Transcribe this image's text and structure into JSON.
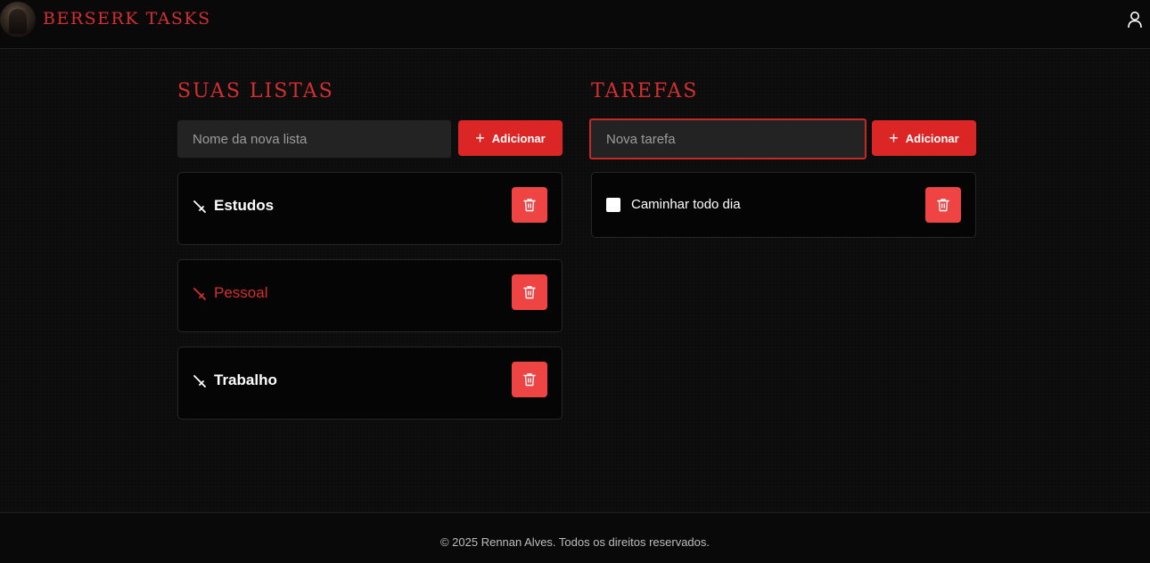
{
  "header": {
    "brand": "BERSERK TASKS",
    "user_icon": "user-icon"
  },
  "lists": {
    "title": "SUAS LISTAS",
    "input_placeholder": "Nome da nova lista",
    "input_value": "",
    "add_label": "Adicionar",
    "items": [
      {
        "name": "Estudos",
        "active": false,
        "icon": "sword-icon"
      },
      {
        "name": "Pessoal",
        "active": true,
        "icon": "sword-icon"
      },
      {
        "name": "Trabalho",
        "active": false,
        "icon": "sword-icon"
      }
    ]
  },
  "tasks": {
    "title": "TAREFAS",
    "input_placeholder": "Nova tarefa",
    "input_value": "",
    "add_label": "Adicionar",
    "items": [
      {
        "text": "Caminhar todo dia",
        "done": false
      }
    ]
  },
  "footer": {
    "copyright": "© 2025 Rennan Alves. Todos os direitos reservados."
  },
  "colors": {
    "accent": "#d32f2f",
    "button": "#dc2626",
    "delete_button": "#ef4444",
    "background": "#0c0c0c"
  }
}
